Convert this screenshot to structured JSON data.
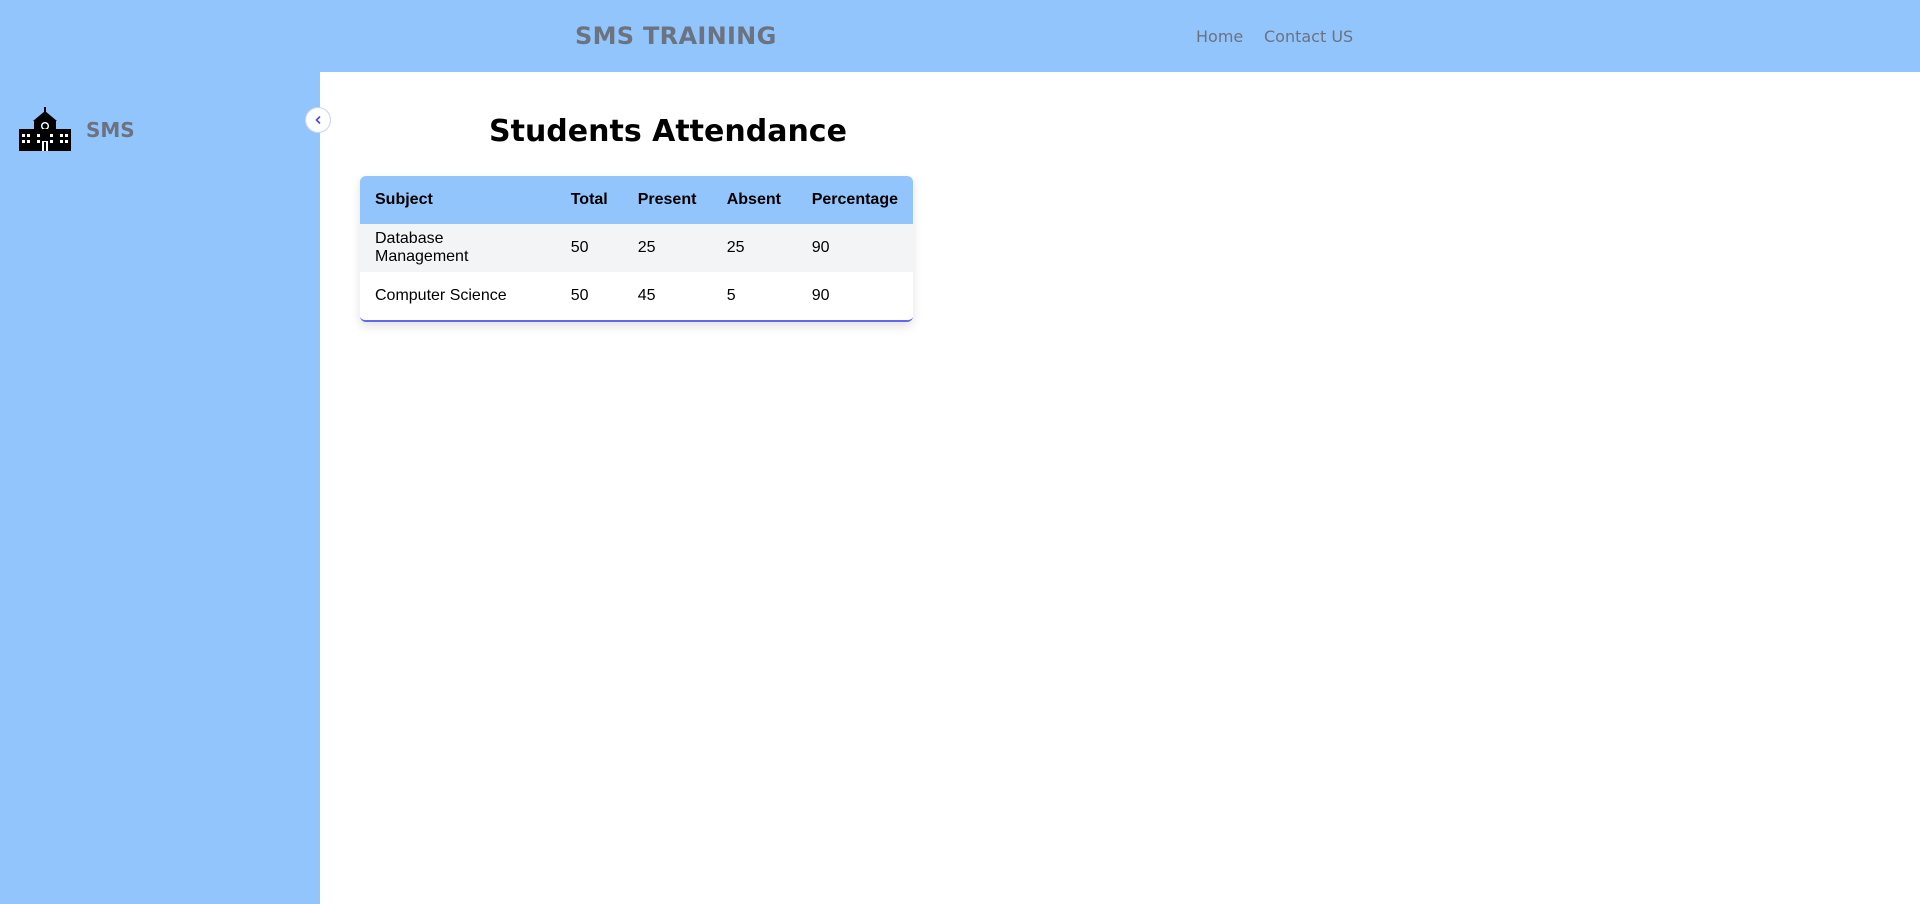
{
  "header": {
    "app_title": "SMS TRAINING",
    "nav": {
      "home": "Home",
      "contact": "Contact US"
    }
  },
  "sidebar": {
    "logo_text": "SMS",
    "logo_icon": "school-building-icon",
    "collapse_icon": "chevron-left-icon"
  },
  "main": {
    "heading": "Students Attendance",
    "table": {
      "columns": [
        "Subject",
        "Total",
        "Present",
        "Absent",
        "Percentage"
      ],
      "rows": [
        [
          "Database Management",
          "50",
          "25",
          "25",
          "90"
        ],
        [
          "Computer Science",
          "50",
          "45",
          "5",
          "90"
        ]
      ]
    }
  },
  "colors": {
    "header_bg": "#93c5fd",
    "sidebar_bg": "#93c5fd",
    "muted_text": "#6b7280",
    "accent": "#6366f1"
  }
}
